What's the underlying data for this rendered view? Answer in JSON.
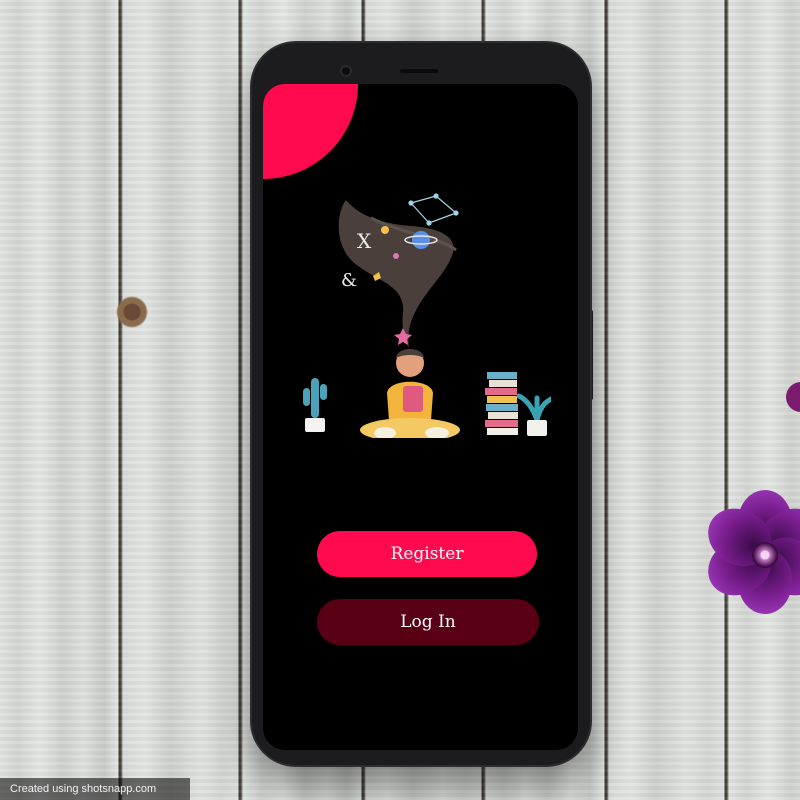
{
  "credit": "Created using shotsnapp.com",
  "app": {
    "register_label": "Register",
    "login_label": "Log In"
  },
  "colors": {
    "accent": "#ff0a4f",
    "login_button": "#5a0014",
    "screen_background": "#000000"
  },
  "illustration": {
    "hair_letters": [
      "X",
      "&"
    ]
  }
}
